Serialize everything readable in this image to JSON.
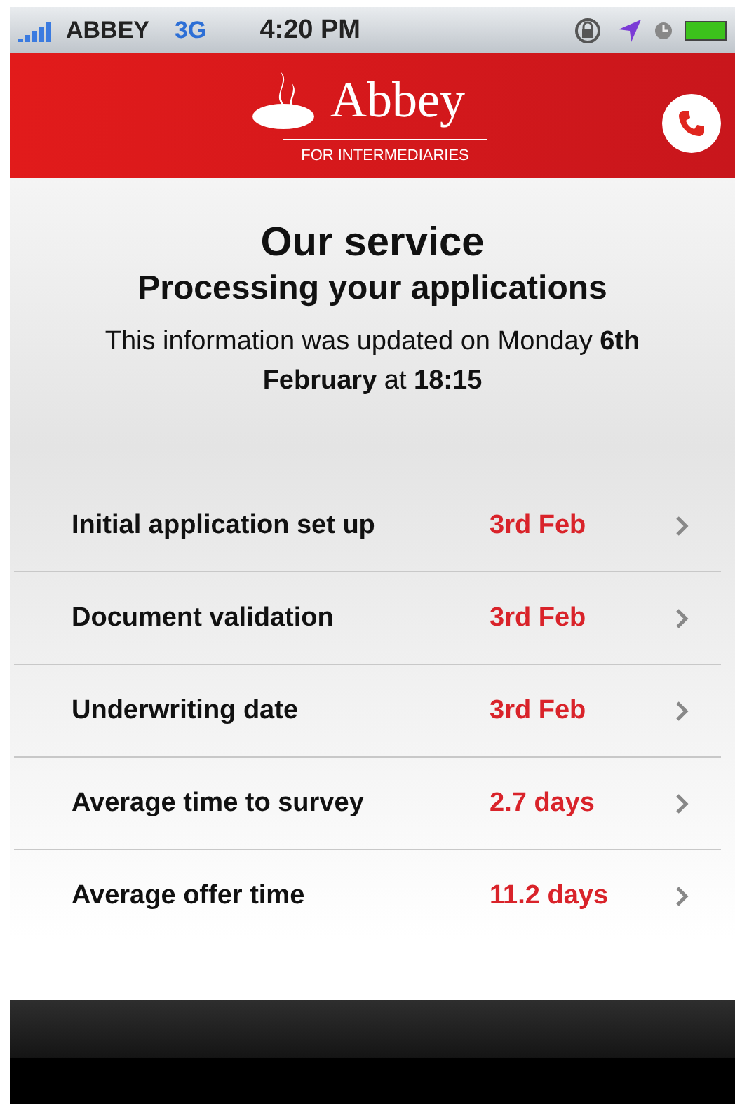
{
  "status_bar": {
    "carrier": "ABBEY",
    "network": "3G",
    "time": "4:20 PM"
  },
  "header": {
    "brand": "Abbey",
    "subtitle": "FOR INTERMEDIARIES"
  },
  "title": "Our service",
  "subtitle": "Processing your applications",
  "updated": "This information was updated on Monday **6th February** at **18:15**",
  "rows": [
    {
      "label": "Initial application set up",
      "value": "3rd Feb"
    },
    {
      "label": "Document validation",
      "value": "3rd Feb"
    },
    {
      "label": "Underwriting date",
      "value": "3rd Feb"
    },
    {
      "label": "Average time to survey",
      "value": "2.7 days"
    },
    {
      "label": "Average offer time",
      "value": "11.2 days"
    }
  ]
}
